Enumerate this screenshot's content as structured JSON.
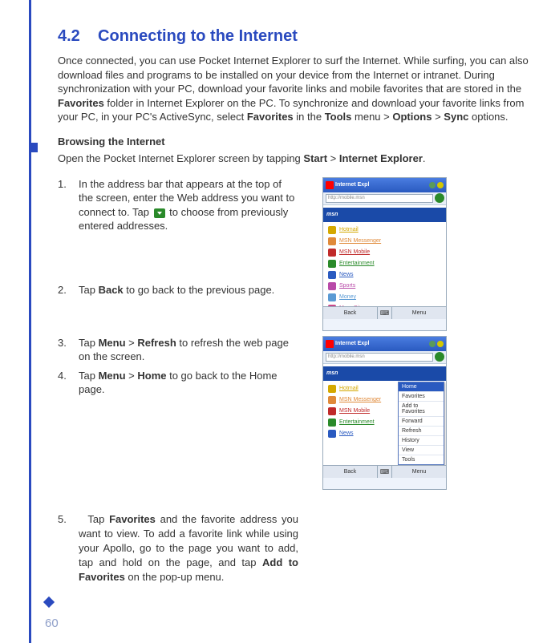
{
  "page_number": "60",
  "section": {
    "number": "4.2",
    "title": "Connecting to the Internet"
  },
  "intro": {
    "p1a": "Once connected, you can use Pocket Internet Explorer to surf the Internet. While surfing, you can also download files and programs to be installed on your device from the Internet or intranet. During synchronization with your PC, download your favorite links and mobile favorites that are stored in the ",
    "b1": "Favorites",
    "p1b": " folder in Internet Explorer on the PC. To synchronize and download your favorite links from your PC, in your PC's ActiveSync, select ",
    "b2": "Favorites",
    "p1c": " in the ",
    "b3": "Tools",
    "p1d": " menu > ",
    "b4": "Options",
    "p1e": " > ",
    "b5": "Sync",
    "p1f": " options."
  },
  "subhead": "Browsing the Internet",
  "open_line": {
    "a": "Open the Pocket Internet Explorer screen by tapping ",
    "b1": "Start",
    "b": " > ",
    "b2": "Internet Explorer",
    "c": "."
  },
  "steps": {
    "s1": {
      "num": "1.",
      "a": "In the address bar that appears at the top of the screen, enter the Web address you want to connect to. Tap ",
      "b": " to choose from previously entered addresses."
    },
    "s2": {
      "num": "2.",
      "a": "Tap ",
      "b1": "Back",
      "b": " to go back to the previous page."
    },
    "s3": {
      "num": "3.",
      "a": "Tap ",
      "b1": "Menu",
      "b": " > ",
      "b2": "Refresh",
      "c": " to refresh the web page on the screen."
    },
    "s4": {
      "num": "4.",
      "a": "Tap ",
      "b1": "Menu",
      "b": " > ",
      "b2": "Home",
      "c": " to go back to the Home page."
    },
    "s5": {
      "num": "5.",
      "a": "Tap ",
      "b1": "Favorites",
      "b": " and the favorite address you want to view. To add a favorite link while using your Apollo, go to the page you want to add, tap and hold on the page, and tap ",
      "b2": "Add to Favorites",
      "c": " on the pop-up menu."
    }
  },
  "screenshot": {
    "title": "Internet Expl",
    "addr": "http://mobile.msn",
    "banner": "msn",
    "items": [
      {
        "color": "#d4a800",
        "text": "Hotmail"
      },
      {
        "color": "#e08a3a",
        "text": "MSN Messenger"
      },
      {
        "color": "#c02a2a",
        "text": "MSN Mobile"
      },
      {
        "color": "#2a8a2a",
        "text": "Entertainment"
      },
      {
        "color": "#2a5ac0",
        "text": "News"
      },
      {
        "color": "#b84aa8",
        "text": "Sports"
      },
      {
        "color": "#5a9ad4",
        "text": "Money"
      },
      {
        "color": "#c84a8a",
        "text": "More Sites"
      }
    ],
    "menu": [
      "Home",
      "Favorites",
      "Add to Favorites",
      "Forward",
      "Refresh",
      "History",
      "View",
      "Tools"
    ],
    "btn_left": "Back",
    "btn_right": "Menu"
  }
}
